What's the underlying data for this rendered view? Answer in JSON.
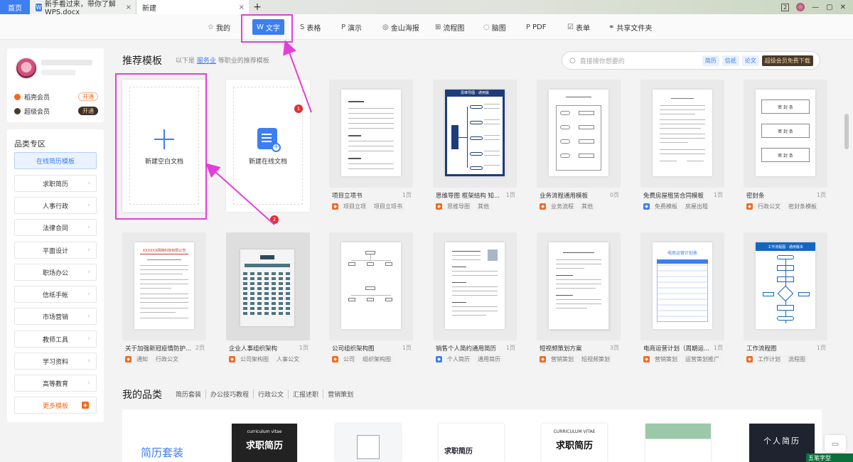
{
  "tabs": {
    "home": "首页",
    "doc": "新手看过来，带你了解WPS.docx",
    "new_tab": "新建",
    "plus": "+",
    "close": "×"
  },
  "window": {
    "badge": "2",
    "min": "—",
    "max": "▢",
    "close": "✕"
  },
  "topnav": [
    {
      "icon": "☆",
      "label": "我的"
    },
    {
      "icon": "W",
      "label": "文字"
    },
    {
      "icon": "S",
      "label": "表格"
    },
    {
      "icon": "P",
      "label": "演示"
    },
    {
      "icon": "◎",
      "label": "金山海报"
    },
    {
      "icon": "⊞",
      "label": "流程图"
    },
    {
      "icon": "◌",
      "label": "脑图"
    },
    {
      "icon": "P",
      "label": "PDF"
    },
    {
      "icon": "☑",
      "label": "表单"
    },
    {
      "icon": "⚭",
      "label": "共享文件夹"
    }
  ],
  "user": {
    "members": [
      {
        "label": "稻壳会员",
        "btn": "开通",
        "color": "#f06a1f"
      },
      {
        "label": "超级会员",
        "btn": "开通",
        "color": "#4a3a2c"
      }
    ]
  },
  "category": {
    "title": "品类专区",
    "items": [
      "在线简历模板",
      "求职简历",
      "人事行政",
      "法律合同",
      "平面设计",
      "职场办公",
      "信纸手帐",
      "市场营销",
      "教师工具",
      "学习资料",
      "高等教育",
      "更多模板"
    ]
  },
  "recommend": {
    "title": "推荐模板",
    "subtitle_pre": "以下是",
    "subtitle_link": "服务业",
    "subtitle_post": "等职业的推荐模板",
    "search_placeholder": "直接搜你想要的",
    "search_tags": [
      "简历",
      "信纸",
      "论文"
    ],
    "vip_btn": "超级会员免费下载",
    "blank": "新建空白文档",
    "online": "新建在线文档",
    "badge1": "1",
    "badge2": "2"
  },
  "templates": [
    {
      "name": "项目立项书",
      "pages": "1页",
      "tags": [
        "项目立项",
        "项目立项书"
      ],
      "logo": "orange"
    },
    {
      "name": "思维导图 框架结构 知...",
      "pages": "1页",
      "tags": [
        "思维导图",
        "其他"
      ],
      "logo": "orange"
    },
    {
      "name": "业务流程通用模板",
      "pages": "0页",
      "tags": [
        "业务流程",
        "其他"
      ],
      "logo": "orange"
    },
    {
      "name": "免费房屋租赁合同模板",
      "pages": "1页",
      "tags": [
        "免费模板",
        "房屋出租"
      ],
      "logo": "blue"
    },
    {
      "name": "密封条",
      "pages": "1页",
      "tags": [
        "行政公文",
        "密封条模板"
      ],
      "logo": "orange"
    },
    {
      "name": "关于加强新冠疫情防护...",
      "pages": "2页",
      "tags": [
        "通知",
        "行政公文"
      ],
      "logo": "orange"
    },
    {
      "name": "企业人事组织架构",
      "pages": "1页",
      "tags": [
        "公司架构图",
        "人事公文"
      ],
      "logo": "orange"
    },
    {
      "name": "公司组织架构图",
      "pages": "1页",
      "tags": [
        "公司",
        "组织架构图"
      ],
      "logo": "orange"
    },
    {
      "name": "销售个人简约通用简历",
      "pages": "1页",
      "tags": [
        "个人简历",
        "通用简历"
      ],
      "logo": "blue"
    },
    {
      "name": "短视频策划方案",
      "pages": "3页",
      "tags": [
        "营销策划",
        "短视频策划"
      ],
      "logo": "orange"
    },
    {
      "name": "电商运营计划（周期运...",
      "pages": "1页",
      "tags": [
        "营销策划",
        "运营策划推广"
      ],
      "logo": "orange"
    },
    {
      "name": "工作流程图",
      "pages": "1页",
      "tags": [
        "工作计划",
        "流程图"
      ],
      "logo": "orange"
    }
  ],
  "thumb_text": {
    "mind": "思维导图 · 通用版",
    "seal": "密 封 条",
    "notice": "XXXXXX网络科技有限公司",
    "flow": "工作流程图 · 通用版本",
    "ecom": "电商运营计划表"
  },
  "my": {
    "title": "我的品类",
    "tabs": [
      "简历套装",
      "办公技巧教程",
      "行政公文",
      "汇报述职",
      "营销策划"
    ],
    "panel_label": "简历套装",
    "resumes": [
      "求职简历",
      "",
      "求职简历",
      "求职简历",
      "",
      "个人简历"
    ],
    "resume_sub": [
      "curriculum vitae",
      "",
      "",
      "CURRICULUM VITAE",
      "",
      ""
    ]
  },
  "ime": "五笔字型",
  "colors": {
    "accent": "#3d7ef0",
    "highlight": "#e23fd8",
    "vip": "#f06a1f"
  }
}
